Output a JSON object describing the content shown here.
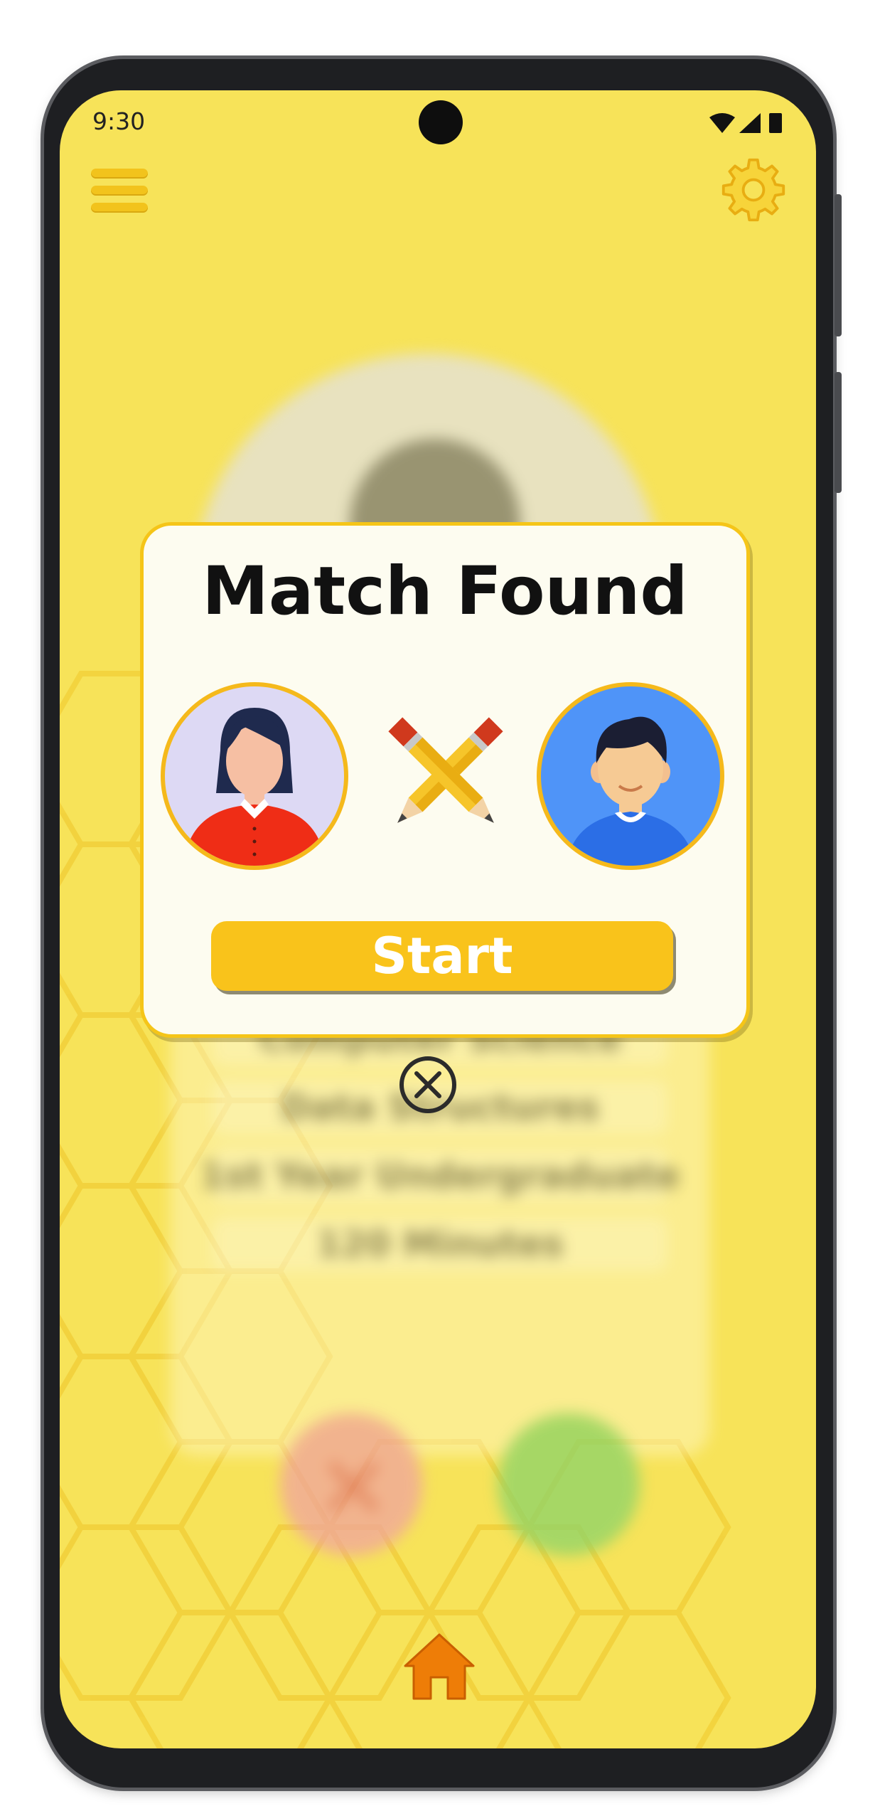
{
  "status_bar": {
    "time": "9:30"
  },
  "icons": {
    "menu": "hamburger-menu-icon",
    "settings": "gear-icon",
    "close": "close-circle-icon",
    "home": "home-icon",
    "versus": "crossed-pencils-icon"
  },
  "modal": {
    "title": "Match Found",
    "start_label": "Start"
  },
  "background_card": {
    "rows": [
      "Computer Science",
      "Data Structures",
      "1st Year Undergraduate",
      "120 Minutes"
    ]
  },
  "colors": {
    "screen_background": "#f7e359",
    "accent_yellow": "#f9c31b",
    "gear": "#f2c31c",
    "home": "#ee7d07",
    "left_avatar_bg": "#ddd9f4",
    "right_avatar_bg": "#4f94f8"
  }
}
